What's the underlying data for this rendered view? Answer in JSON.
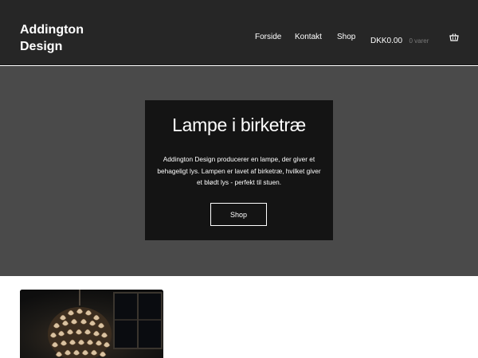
{
  "header": {
    "site_title": "Addington Design",
    "nav": {
      "items": [
        {
          "label": "Forside"
        },
        {
          "label": "Kontakt"
        },
        {
          "label": "Shop"
        }
      ],
      "cart": {
        "amount": "DKK0.00",
        "count": "0 varer",
        "icon": "basket-icon"
      }
    }
  },
  "hero": {
    "title": "Lampe i birketræ",
    "text": "Addington Design producerer en lampe, der giver et behageligt lys. Lampen er lavet af birketræ, hvilket giver et blødt lys - perfekt til stuen.",
    "button_label": "Shop"
  },
  "colors": {
    "header_bg": "#262626",
    "hero_bg": "#4a4a4a",
    "hero_box_bg": "#141414",
    "text": "#ffffff",
    "muted": "#7a7a7a"
  }
}
